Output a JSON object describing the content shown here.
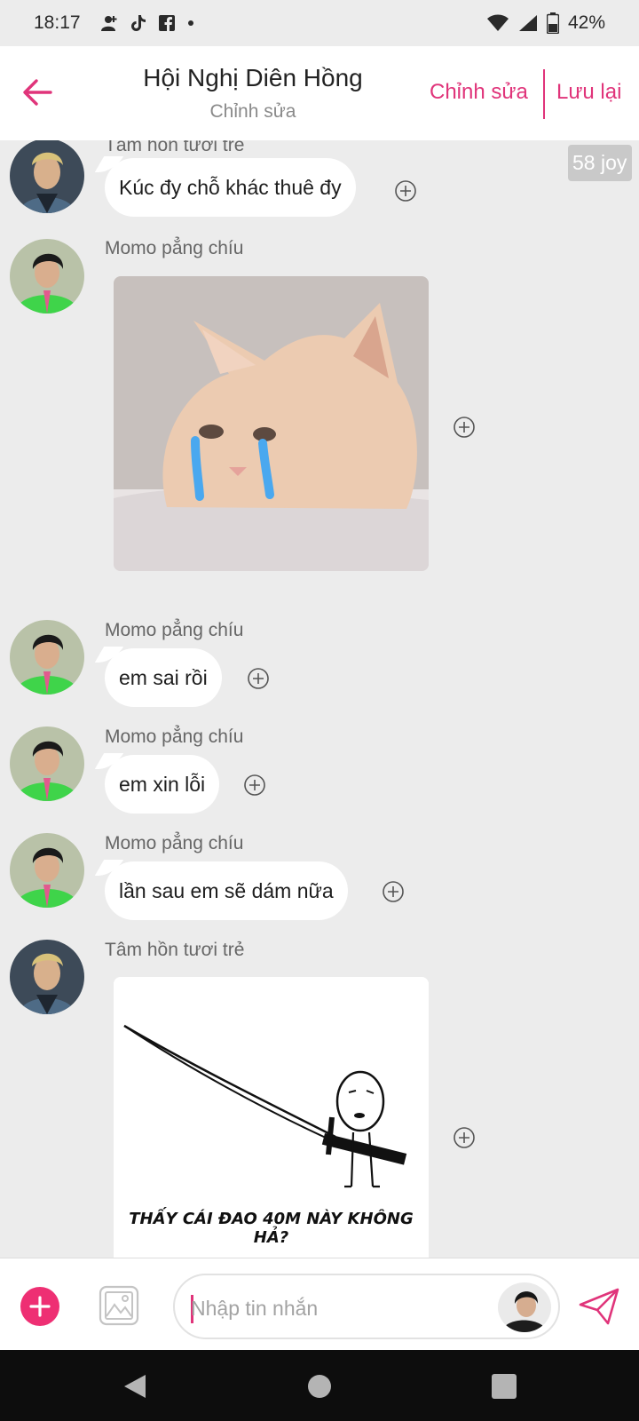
{
  "status_bar": {
    "time": "18:17",
    "battery": "42%",
    "icons": [
      "person-add-icon",
      "tiktok-icon",
      "facebook-icon",
      "dot-icon",
      "wifi-icon",
      "signal-icon",
      "battery-icon"
    ]
  },
  "header": {
    "title": "Hội Nghị Diên Hồng",
    "subtitle": "Chỉnh sửa",
    "edit_label": "Chỉnh sửa",
    "save_label": "Lưu lại",
    "accent_color": "#e0347a"
  },
  "chat": {
    "reaction_count": "58 joy",
    "messages": [
      {
        "sender": "Tâm hồn tươi trẻ",
        "type": "text",
        "text": "Kúc đy chỗ khác thuê đy"
      },
      {
        "sender": "Momo pẳng chíu",
        "type": "image",
        "image": "crying-cat-sticker"
      },
      {
        "sender": "Momo pẳng chíu",
        "type": "text",
        "text": "em sai rồi"
      },
      {
        "sender": "Momo pẳng chíu",
        "type": "text",
        "text": "em xin lỗi"
      },
      {
        "sender": "Momo pẳng chíu",
        "type": "text",
        "text": "lần sau em sẽ dám nữa"
      },
      {
        "sender": "Tâm hồn tươi trẻ",
        "type": "image",
        "image": "sword-meme-sticker",
        "caption": "THẤY CÁI ĐAO 40M NÀY KHÔNG HẢ?"
      }
    ]
  },
  "input": {
    "placeholder": "Nhập tin nhắn"
  },
  "colors": {
    "accent": "#e0347a",
    "plus_button": "#ee2f73",
    "background": "#ececec",
    "bubble": "#ffffff"
  }
}
